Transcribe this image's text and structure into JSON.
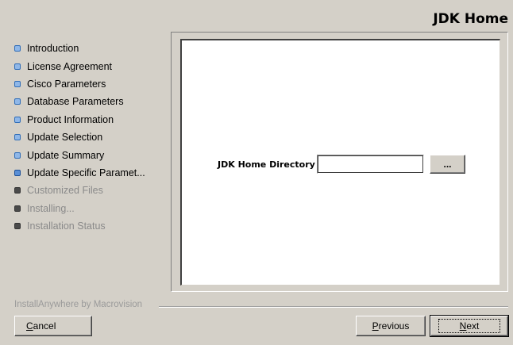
{
  "header": {
    "title": "JDK Home"
  },
  "steps": [
    {
      "label": "Introduction",
      "state": "done"
    },
    {
      "label": "License Agreement",
      "state": "done"
    },
    {
      "label": "Cisco Parameters",
      "state": "done"
    },
    {
      "label": "Database Parameters",
      "state": "done"
    },
    {
      "label": "Product Information",
      "state": "done"
    },
    {
      "label": "Update Selection",
      "state": "done"
    },
    {
      "label": "Update Summary",
      "state": "done"
    },
    {
      "label": "Update Specific Paramet...",
      "state": "current"
    },
    {
      "label": "Customized Files",
      "state": "todo"
    },
    {
      "label": "Installing...",
      "state": "todo"
    },
    {
      "label": "Installation Status",
      "state": "todo"
    }
  ],
  "form": {
    "jdk_label": "JDK Home Directory",
    "jdk_value": "",
    "browse_label": "..."
  },
  "footer": {
    "brand": "InstallAnywhere by Macrovision",
    "cancel_mnemonic": "C",
    "cancel_rest": "ancel",
    "previous_mnemonic": "P",
    "previous_rest": "revious",
    "next_mnemonic": "N",
    "next_rest": "ext"
  },
  "colors": {
    "background": "#d4d0c8",
    "done_bullet": "#8fb7e8",
    "todo_bullet": "#4a4a4a"
  }
}
